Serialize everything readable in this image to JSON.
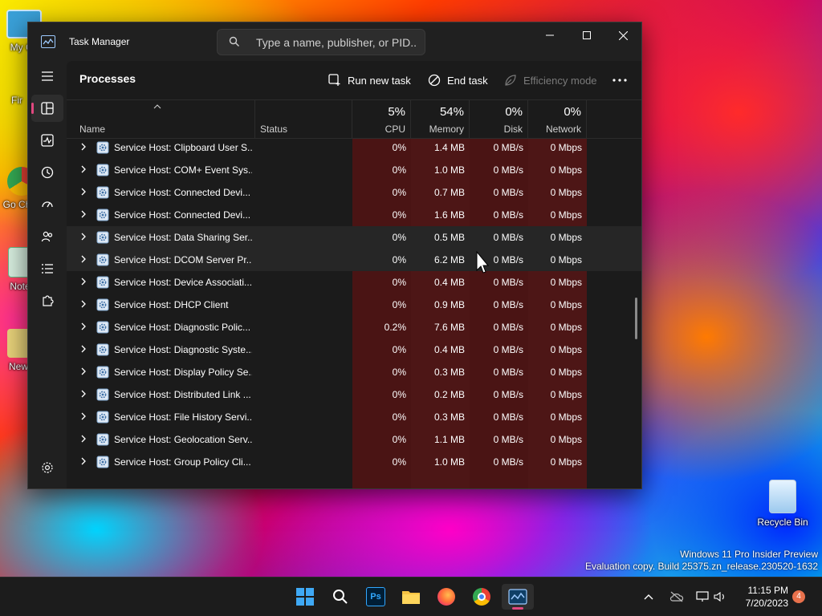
{
  "desktop": {
    "icons": [
      {
        "label": "My Co"
      },
      {
        "label": "Fir"
      },
      {
        "label": "Go Chr"
      },
      {
        "label": "Note"
      },
      {
        "label": "New"
      },
      {
        "label": "Recycle Bin"
      }
    ],
    "watermark": {
      "line1": "Windows 11 Pro Insider Preview",
      "line2": "Evaluation copy. Build 25375.zn_release.230520-1632"
    }
  },
  "window": {
    "title": "Task Manager",
    "search_placeholder": "Type a name, publisher, or PID...",
    "minimize_icon": "minimize-icon",
    "maximize_icon": "maximize-icon",
    "close_icon": "close-icon"
  },
  "toolbar": {
    "page_title": "Processes",
    "run_new_task": "Run new task",
    "end_task": "End task",
    "efficiency_mode": "Efficiency mode",
    "more_icon": "more-icon"
  },
  "columns": {
    "name": "Name",
    "status": "Status",
    "cpu_pct": "5%",
    "cpu": "CPU",
    "memory_pct": "54%",
    "memory": "Memory",
    "disk_pct": "0%",
    "disk": "Disk",
    "network_pct": "0%",
    "network": "Network"
  },
  "processes": [
    {
      "name": "Service Host: Clipboard User S...",
      "cpu": "0%",
      "memory": "1.4 MB",
      "disk": "0 MB/s",
      "network": "0 Mbps"
    },
    {
      "name": "Service Host: COM+ Event Sys...",
      "cpu": "0%",
      "memory": "1.0 MB",
      "disk": "0 MB/s",
      "network": "0 Mbps"
    },
    {
      "name": "Service Host: Connected Devi...",
      "cpu": "0%",
      "memory": "0.7 MB",
      "disk": "0 MB/s",
      "network": "0 Mbps"
    },
    {
      "name": "Service Host: Connected Devi...",
      "cpu": "0%",
      "memory": "1.6 MB",
      "disk": "0 MB/s",
      "network": "0 Mbps"
    },
    {
      "name": "Service Host: Data Sharing Ser...",
      "cpu": "0%",
      "memory": "0.5 MB",
      "disk": "0 MB/s",
      "network": "0 Mbps"
    },
    {
      "name": "Service Host: DCOM Server Pr...",
      "cpu": "0%",
      "memory": "6.2 MB",
      "disk": "0 MB/s",
      "network": "0 Mbps"
    },
    {
      "name": "Service Host: Device Associati...",
      "cpu": "0%",
      "memory": "0.4 MB",
      "disk": "0 MB/s",
      "network": "0 Mbps"
    },
    {
      "name": "Service Host: DHCP Client",
      "cpu": "0%",
      "memory": "0.9 MB",
      "disk": "0 MB/s",
      "network": "0 Mbps"
    },
    {
      "name": "Service Host: Diagnostic Polic...",
      "cpu": "0.2%",
      "memory": "7.6 MB",
      "disk": "0 MB/s",
      "network": "0 Mbps"
    },
    {
      "name": "Service Host: Diagnostic Syste...",
      "cpu": "0%",
      "memory": "0.4 MB",
      "disk": "0 MB/s",
      "network": "0 Mbps"
    },
    {
      "name": "Service Host: Display Policy Se...",
      "cpu": "0%",
      "memory": "0.3 MB",
      "disk": "0 MB/s",
      "network": "0 Mbps"
    },
    {
      "name": "Service Host: Distributed Link ...",
      "cpu": "0%",
      "memory": "0.2 MB",
      "disk": "0 MB/s",
      "network": "0 Mbps"
    },
    {
      "name": "Service Host: File History Servi...",
      "cpu": "0%",
      "memory": "0.3 MB",
      "disk": "0 MB/s",
      "network": "0 Mbps"
    },
    {
      "name": "Service Host: Geolocation Serv...",
      "cpu": "0%",
      "memory": "1.1 MB",
      "disk": "0 MB/s",
      "network": "0 Mbps"
    },
    {
      "name": "Service Host: Group Policy Cli...",
      "cpu": "0%",
      "memory": "1.0 MB",
      "disk": "0 MB/s",
      "network": "0 Mbps"
    }
  ],
  "taskbar": {
    "time": "11:15 PM",
    "date": "7/20/2023",
    "notification_count": "4",
    "ps_label": "Ps"
  },
  "colors": {
    "accent": "#e0487f",
    "heat": "#4a1414"
  }
}
